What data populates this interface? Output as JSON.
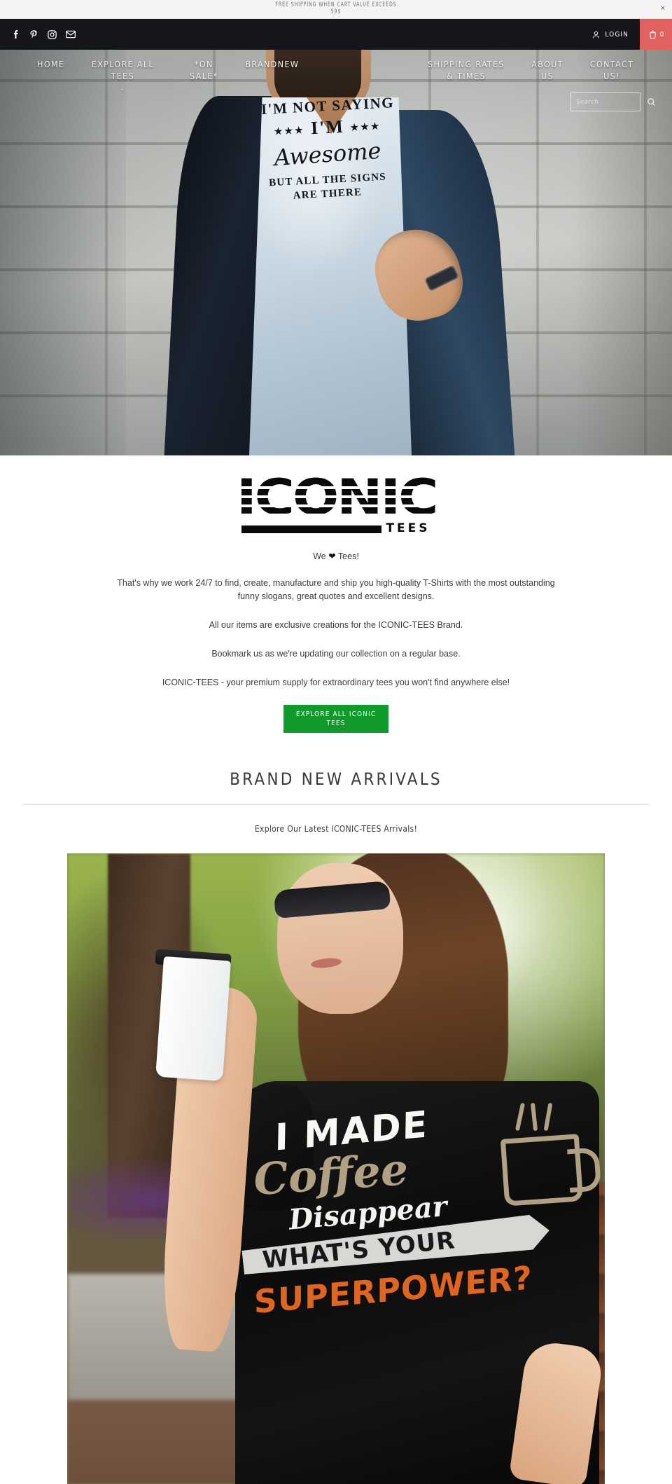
{
  "announcement": {
    "text": "FREE SHIPPING WHEN CART VALUE EXCEEDS 59$",
    "close_label": "×"
  },
  "utility": {
    "socials": [
      {
        "name": "facebook-icon",
        "label": "Facebook"
      },
      {
        "name": "pinterest-icon",
        "label": "Pinterest"
      },
      {
        "name": "instagram-icon",
        "label": "Instagram"
      },
      {
        "name": "email-icon",
        "label": "Email"
      }
    ],
    "login_label": "LOGIN",
    "cart_count": "0"
  },
  "nav": {
    "left": [
      {
        "label": "HOME",
        "has_caret": false
      },
      {
        "label": "EXPLORE ALL TEES",
        "has_caret": true
      },
      {
        "label": "*ON SALE*",
        "has_caret": false
      },
      {
        "label": "BRANDNEW",
        "has_caret": false
      }
    ],
    "right": [
      {
        "label": "SHIPPING RATES & TIMES",
        "has_caret": false
      },
      {
        "label": "ABOUT US",
        "has_caret": false
      },
      {
        "label": "CONTACT US!",
        "has_caret": false
      }
    ],
    "caret_glyph": "⌄"
  },
  "search": {
    "placeholder": "Search",
    "value": ""
  },
  "hero": {
    "alt": "Man in blazer pointing at white t-shirt",
    "tee_line1": "I'M NOT SAYING",
    "tee_line2_stars_left": "★★★",
    "tee_line2": "I'M",
    "tee_line2_stars_right": "★★★",
    "tee_line3": "Awesome",
    "tee_line4": "BUT ALL THE SIGNS",
    "tee_line5": "ARE THERE"
  },
  "brand": {
    "logo_word": "ICONIC",
    "logo_sub": "TEES",
    "tagline_before": "We ",
    "tagline_heart": "❤",
    "tagline_after": " Tees!",
    "paragraphs": [
      "That's why we work 24/7 to find, create, manufacture and ship you high-quality T-Shirts with the most outstanding funny slogans, great quotes and excellent designs.",
      "All our items are exclusive creations for the ICONIC-TEES Brand.",
      "Bookmark us as we're updating our collection on a regular base.",
      "ICONIC-TEES - your premium supply for extraordinary tees you won't find anywhere else!"
    ],
    "cta_label": "EXPLORE ALL ICONIC TEES"
  },
  "section": {
    "title": "BRAND NEW ARRIVALS",
    "subtitle": "Explore Our Latest ICONIC-TEES Arrivals!"
  },
  "product": {
    "alt": "Woman holding coffee cup wearing black coffee superpower t-shirt",
    "art_line1": "I MADE",
    "art_line2": "Coffee",
    "art_line3": "Disappear",
    "art_line4": "WHAT'S YOUR",
    "art_line5": "SUPERPOWER?"
  },
  "colors": {
    "cart_badge": "#e0615f",
    "cta_green": "#0f9a2b",
    "header_bar": "#141619",
    "announcement_bg": "#f4f4f4",
    "art_orange": "#e0651f",
    "art_tan": "#b2a084"
  }
}
